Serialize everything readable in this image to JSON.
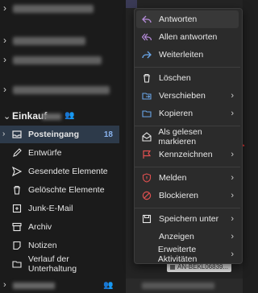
{
  "sidebar": {
    "group_name": "Einkauf",
    "folders": [
      {
        "label": "Posteingang",
        "count": "18",
        "icon": "inbox-icon"
      },
      {
        "label": "Entwürfe",
        "icon": "pencil-icon"
      },
      {
        "label": "Gesendete Elemente",
        "icon": "send-icon"
      },
      {
        "label": "Gelöschte Elemente",
        "icon": "trash-icon"
      },
      {
        "label": "Junk-E-Mail",
        "icon": "junk-icon"
      },
      {
        "label": "Archiv",
        "icon": "archive-icon"
      },
      {
        "label": "Notizen",
        "icon": "note-icon"
      },
      {
        "label": "Verlauf der Unterhaltung",
        "icon": "folder-icon"
      }
    ]
  },
  "menu": {
    "items": [
      {
        "label": "Antworten",
        "icon": "reply-icon"
      },
      {
        "label": "Allen antworten",
        "icon": "reply-all-icon"
      },
      {
        "label": "Weiterleiten",
        "icon": "forward-icon"
      },
      {
        "label": "Löschen",
        "icon": "trash-icon"
      },
      {
        "label": "Verschieben",
        "icon": "move-icon"
      },
      {
        "label": "Kopieren",
        "icon": "copy-icon"
      },
      {
        "label": "Als gelesen markieren",
        "icon": "envelope-open-icon"
      },
      {
        "label": "Kennzeichnen",
        "icon": "flag-icon"
      },
      {
        "label": "Melden",
        "icon": "shield-icon"
      },
      {
        "label": "Blockieren",
        "icon": "block-icon"
      },
      {
        "label": "Speichern unter",
        "icon": "save-icon"
      },
      {
        "label": "Anzeigen",
        "icon": "view-icon"
      },
      {
        "label": "Erweiterte Aktivitäten",
        "icon": "more-icon"
      }
    ]
  },
  "annotation_text": "AN-BEKL06839...",
  "colors": {
    "accent": "#8ab4f0",
    "reply_purple": "#b48ad8",
    "forward_blue": "#6aa6e8",
    "danger_red": "#e05050"
  }
}
